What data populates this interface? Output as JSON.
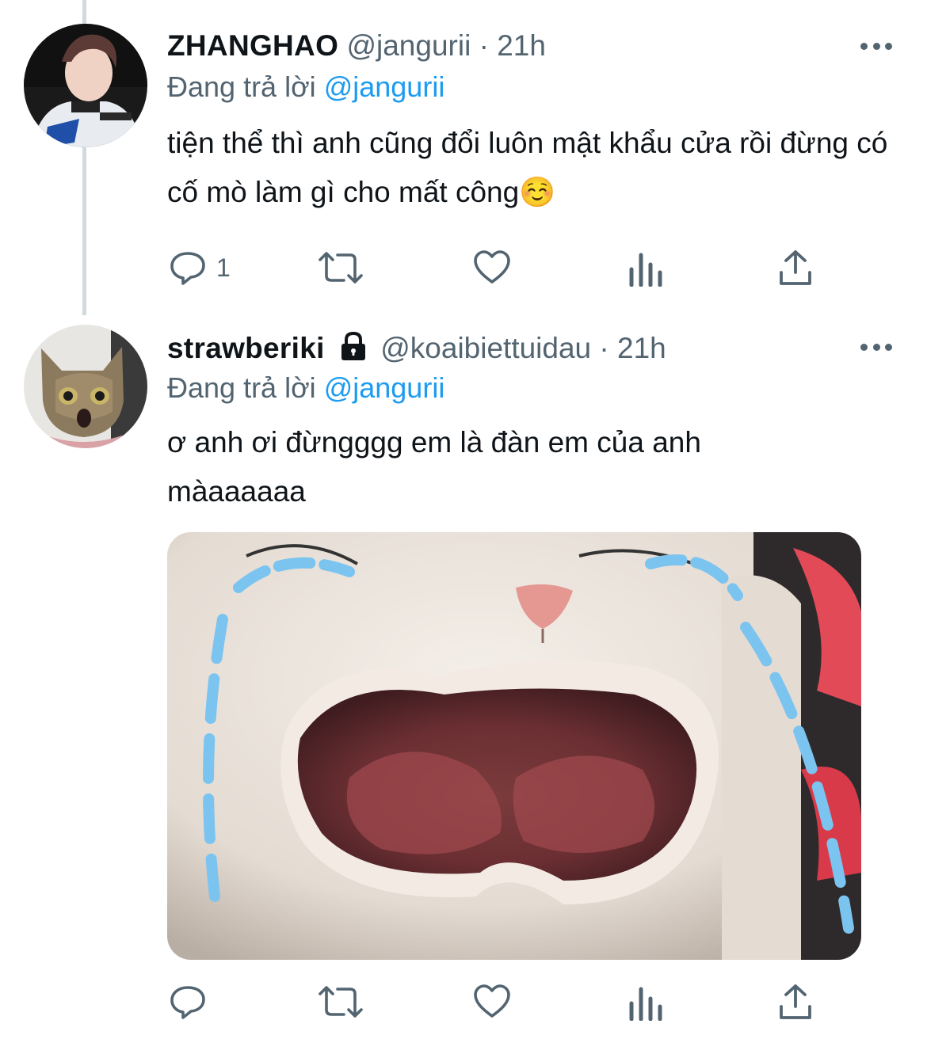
{
  "tweets": [
    {
      "display_name": "ZHANGHAO",
      "handle": "@jangurii",
      "separator": "·",
      "time": "21h",
      "replying_prefix": "Đang trả lời",
      "replying_to": "@jangurii",
      "text": "tiện thể thì anh cũng đổi luôn mật khẩu cửa rồi đừng có cố mò làm gì cho mất công☺️",
      "reply_count": "1",
      "avatar_icon": "profile-photo"
    },
    {
      "display_name": "strawberiki",
      "protected_icon": "lock-icon",
      "handle": "@koaibiettuidau",
      "separator": "·",
      "time": "21h",
      "replying_prefix": "Đang trả lời",
      "replying_to": "@jangurii",
      "text": "ơ anh ơi đừngggg em là đàn em của anh màaaaaaa",
      "reply_count": "",
      "avatar_icon": "cat-photo",
      "media": "crying-cat-meme"
    }
  ],
  "colors": {
    "accent": "#1d9bf0",
    "secondary": "#536471",
    "thread_line": "#cfd9de"
  }
}
